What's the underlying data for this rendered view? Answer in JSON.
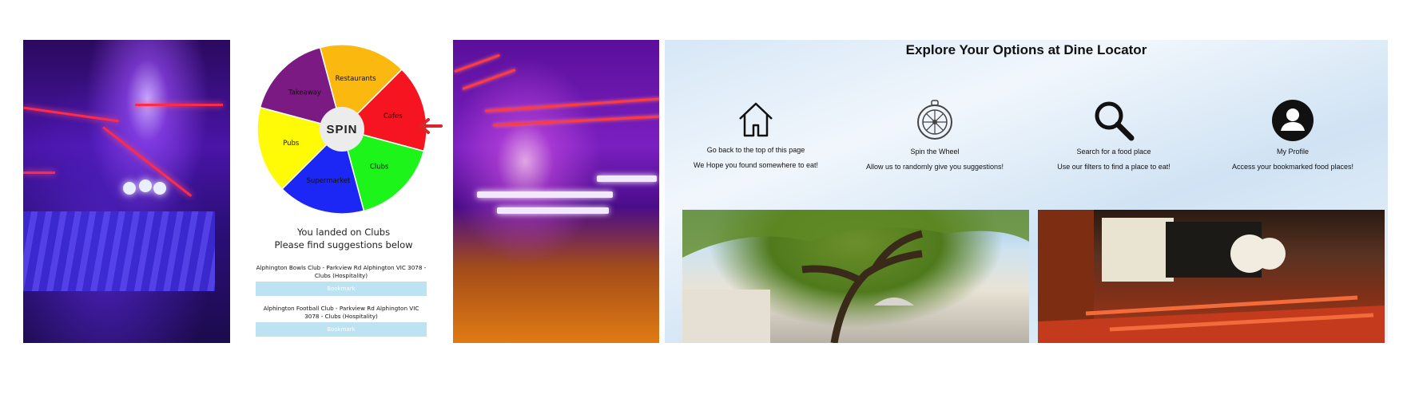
{
  "spinner": {
    "button_label": "SPIN",
    "segments": [
      {
        "label": "Restaurants",
        "color": "#fbb80f"
      },
      {
        "label": "Cafes",
        "color": "#f5141f"
      },
      {
        "label": "Clubs",
        "color": "#1df51a"
      },
      {
        "label": "Supermarket",
        "color": "#1d27f5"
      },
      {
        "label": "Pubs",
        "color": "#fffb07"
      },
      {
        "label": "Takeaway",
        "color": "#7b1a82"
      }
    ],
    "pointer_color": "#d9262a",
    "result_line1": "You landed on Clubs",
    "result_line2": "Please find suggestions below",
    "suggestions": [
      {
        "text": "Alphington Bowls Club - Parkview Rd Alphington VIC 3078 - Clubs (Hospitality)",
        "button": "Bookmark"
      },
      {
        "text": "Alphington Football Club - Parkview Rd Alphington VIC 3078 - Clubs (Hospitality)",
        "button": "Bookmark"
      }
    ]
  },
  "explore": {
    "title": "Explore Your Options at Dine Locator",
    "options": [
      {
        "title": "Go back to the top of this page",
        "desc": "We Hope you found somewhere to eat!",
        "icon": "home-icon"
      },
      {
        "title": "Spin the Wheel",
        "desc": "Allow us to randomly give you suggestions!",
        "icon": "wheel-icon"
      },
      {
        "title": "Search for a food place",
        "desc": "Use our filters to find a place to eat!",
        "icon": "search-icon"
      },
      {
        "title": "My Profile",
        "desc": "Access your bookmarked food places!",
        "icon": "profile-icon"
      }
    ]
  }
}
